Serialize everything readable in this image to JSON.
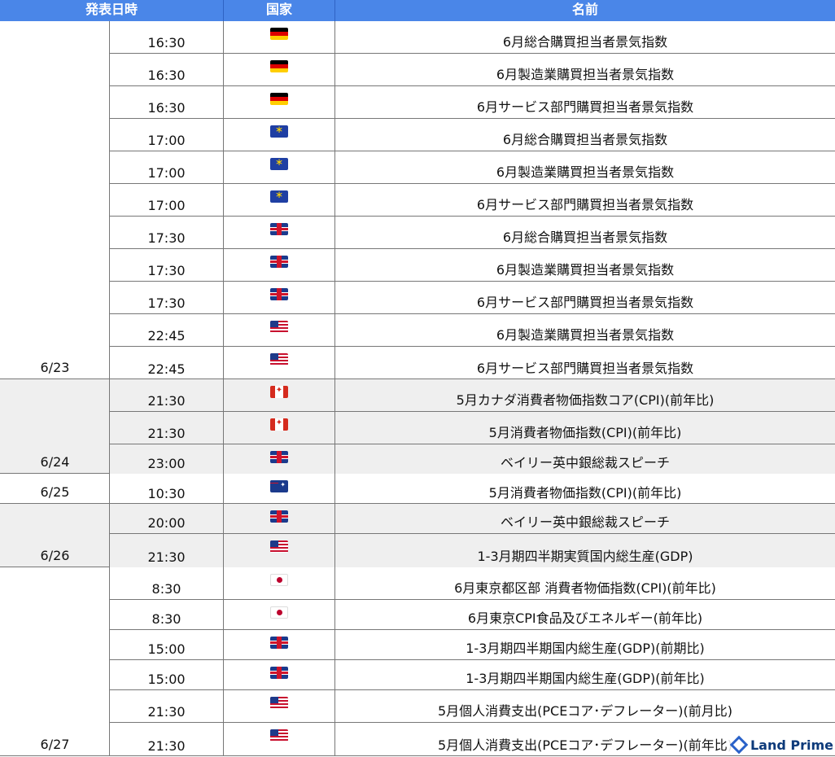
{
  "header": {
    "date_time": "発表日時",
    "country": "国家",
    "name": "名前"
  },
  "groups": [
    {
      "date": "6/23",
      "rows": [
        {
          "time": "16:30",
          "flag": "de",
          "name": "6月総合購買担当者景気指数"
        },
        {
          "time": "16:30",
          "flag": "de",
          "name": "6月製造業購買担当者景気指数"
        },
        {
          "time": "16:30",
          "flag": "de",
          "name": "6月サービス部門購買担当者景気指数"
        },
        {
          "time": "17:00",
          "flag": "eu",
          "name": "6月総合購買担当者景気指数"
        },
        {
          "time": "17:00",
          "flag": "eu",
          "name": "6月製造業購買担当者景気指数"
        },
        {
          "time": "17:00",
          "flag": "eu",
          "name": "6月サービス部門購買担当者景気指数"
        },
        {
          "time": "17:30",
          "flag": "gb",
          "name": "6月総合購買担当者景気指数"
        },
        {
          "time": "17:30",
          "flag": "gb",
          "name": "6月製造業購買担当者景気指数"
        },
        {
          "time": "17:30",
          "flag": "gb",
          "name": "6月サービス部門購買担当者景気指数"
        },
        {
          "time": "22:45",
          "flag": "us",
          "name": "6月製造業購買担当者景気指数"
        },
        {
          "time": "22:45",
          "flag": "us",
          "name": "6月サービス部門購買担当者景気指数"
        }
      ]
    },
    {
      "date": "6/24",
      "rows": [
        {
          "time": "21:30",
          "flag": "ca",
          "name": "5月カナダ消費者物価指数コア(CPI)(前年比)"
        },
        {
          "time": "21:30",
          "flag": "ca",
          "name": "5月消費者物価指数(CPI)(前年比)"
        },
        {
          "time": "23:00",
          "flag": "gb",
          "name": "ベイリー英中銀総裁スピーチ"
        }
      ]
    },
    {
      "date": "6/25",
      "rows": [
        {
          "time": "10:30",
          "flag": "au",
          "name": "5月消費者物価指数(CPI)(前年比)"
        }
      ]
    },
    {
      "date": "6/26",
      "rows": [
        {
          "time": "20:00",
          "flag": "gb",
          "name": "ベイリー英中銀総裁スピーチ"
        },
        {
          "time": "21:30",
          "flag": "us",
          "name": "1-3月期四半期実質国内総生産(GDP)"
        }
      ]
    },
    {
      "date": "6/27",
      "rows": [
        {
          "time": "8:30",
          "flag": "jp",
          "name": "6月東京都区部 消費者物価指数(CPI)(前年比)"
        },
        {
          "time": "8:30",
          "flag": "jp",
          "name": "6月東京CPI食品及びエネルギー(前年比)"
        },
        {
          "time": "15:00",
          "flag": "gb",
          "name": "1-3月期四半期国内総生産(GDP)(前期比)"
        },
        {
          "time": "15:00",
          "flag": "gb",
          "name": "1-3月期四半期国内総生産(GDP)(前年比)"
        },
        {
          "time": "21:30",
          "flag": "us",
          "name": "5月個人消費支出(PCEコア･デフレーター)(前月比)"
        },
        {
          "time": "21:30",
          "flag": "us",
          "name": "5月個人消費支出(PCEコア･デフレーター)(前年比)"
        }
      ]
    }
  ],
  "logo": {
    "text": "Land Prime"
  }
}
